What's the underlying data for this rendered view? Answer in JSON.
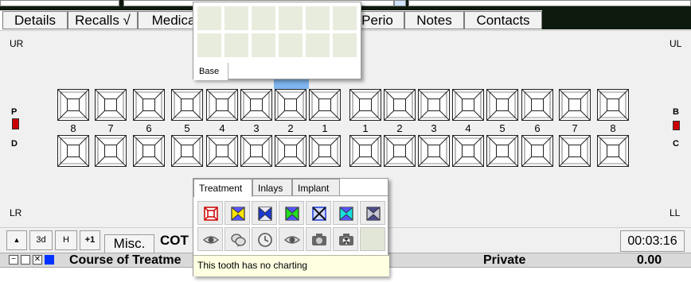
{
  "tabs": [
    "Details",
    "Recalls √",
    "Medica",
    "Perio",
    "Notes",
    "Contacts"
  ],
  "quadrants": {
    "upper_right": "UR",
    "upper_left": "UL",
    "lower_right": "LR",
    "lower_left": "LL"
  },
  "side_labels": {
    "left_top": "P",
    "left_bottom": "D",
    "right_top": "B",
    "right_bottom": "C"
  },
  "tooth_numbers_right": [
    "8",
    "7",
    "6",
    "5",
    "4",
    "3",
    "2",
    "1"
  ],
  "tooth_numbers_left": [
    "1",
    "2",
    "3",
    "4",
    "5",
    "6",
    "7",
    "8"
  ],
  "toolbar": {
    "up_label": "▲",
    "three_d_label": "3d",
    "h_label": "H",
    "plus_one_label": "+1",
    "misc_tab": "Misc.",
    "cot_label": "COT",
    "timer": "00:03:16"
  },
  "course": {
    "title": "Course of Treatme",
    "fee_type": "Private",
    "total": "0.00"
  },
  "base_popup": {
    "label": "Base"
  },
  "treatment_popup": {
    "tabs": [
      "Treatment",
      "Inlays",
      "Implant"
    ],
    "row1_icons": [
      "red-crown-icon",
      "yellow-crown-icon",
      "blue-crown-icon",
      "green-crown-icon",
      "blue-x-crown-icon",
      "cyan-crown-icon",
      "grey-crown-icon"
    ],
    "row2_icons": [
      "eye-icon",
      "speech-icon",
      "clock-icon",
      "eye-icon",
      "camera-icon",
      "radiation-camera-icon"
    ],
    "tooltip": "This tooth has no charting"
  },
  "colors": {
    "highlight": "#7fb6ef",
    "tooltip_bg": "#ffffe1",
    "top_strip": "#0e1a0e"
  }
}
